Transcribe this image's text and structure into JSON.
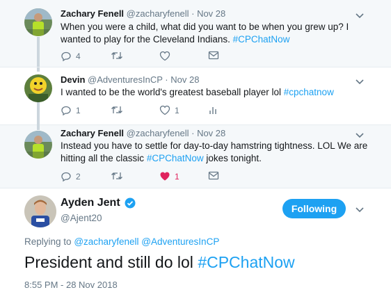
{
  "tweets": [
    {
      "name": "Zachary Fenell",
      "handle": "@zacharyfenell",
      "dot": "·",
      "date": "Nov 28",
      "text_parts": [
        "When you were a child, what did you want to be when you grew up? I wanted to play for the Cleveland Indians. ",
        "#CPChatNow"
      ],
      "reply_count": "4",
      "retweet_count": "",
      "like_count": "",
      "liked": false,
      "icons": [
        "reply-icon",
        "retweet-icon",
        "heart-icon",
        "message-icon"
      ]
    },
    {
      "name": "Devin",
      "handle": "@AdventuresInCP",
      "dot": "·",
      "date": "Nov 28",
      "text_parts": [
        "I wanted to be the world's greatest baseball player lol ",
        "#cpchatnow"
      ],
      "reply_count": "1",
      "retweet_count": "",
      "like_count": "1",
      "liked": false,
      "icons": [
        "reply-icon",
        "retweet-icon",
        "heart-icon",
        "analytics-icon"
      ]
    },
    {
      "name": "Zachary Fenell",
      "handle": "@zacharyfenell",
      "dot": "·",
      "date": "Nov 28",
      "text_parts": [
        "Instead you have to settle for day-to-day hamstring tightness. LOL We are hitting all the classic ",
        "#CPChatNow",
        " jokes tonight."
      ],
      "reply_count": "2",
      "retweet_count": "",
      "like_count": "1",
      "liked": true,
      "icons": [
        "reply-icon",
        "retweet-icon",
        "heart-filled-icon",
        "message-icon"
      ]
    }
  ],
  "main_tweet": {
    "name": "Ayden Jent",
    "handle": "@Ajent20",
    "verified": true,
    "follow_label": "Following",
    "replying_prefix": "Replying to",
    "replying_to": "@zacharyfenell @AdventuresInCP",
    "text": "President and still do lol ",
    "hashtag": "#CPChatNow",
    "timestamp": "8:55 PM - 28 Nov 2018"
  },
  "colors": {
    "accent": "#1da1f2",
    "like_red": "#e0245e",
    "muted": "#657786",
    "thread_bg": "#f5f8fa"
  }
}
